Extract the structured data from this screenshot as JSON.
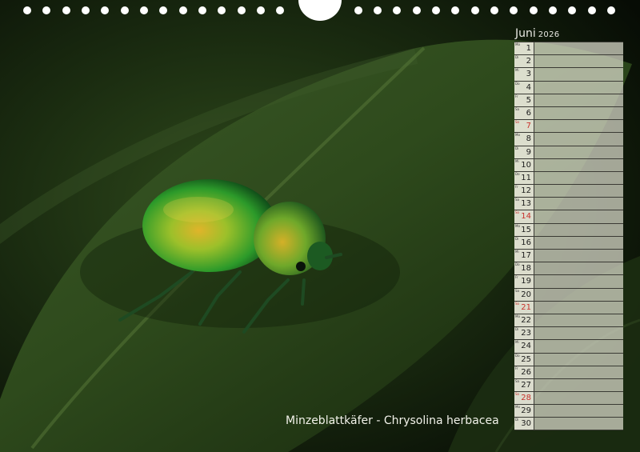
{
  "calendar": {
    "month": "Juni",
    "year": "2026",
    "days": [
      {
        "day": "1",
        "weekday": "Mo",
        "sunday": false
      },
      {
        "day": "2",
        "weekday": "Di",
        "sunday": false
      },
      {
        "day": "3",
        "weekday": "Mi",
        "sunday": false
      },
      {
        "day": "4",
        "weekday": "Do",
        "sunday": false
      },
      {
        "day": "5",
        "weekday": "Fr",
        "sunday": false
      },
      {
        "day": "6",
        "weekday": "Sa",
        "sunday": false
      },
      {
        "day": "7",
        "weekday": "So",
        "sunday": true
      },
      {
        "day": "8",
        "weekday": "Mo",
        "sunday": false
      },
      {
        "day": "9",
        "weekday": "Di",
        "sunday": false
      },
      {
        "day": "10",
        "weekday": "Mi",
        "sunday": false
      },
      {
        "day": "11",
        "weekday": "Do",
        "sunday": false
      },
      {
        "day": "12",
        "weekday": "Fr",
        "sunday": false
      },
      {
        "day": "13",
        "weekday": "Sa",
        "sunday": false
      },
      {
        "day": "14",
        "weekday": "So",
        "sunday": true
      },
      {
        "day": "15",
        "weekday": "Mo",
        "sunday": false
      },
      {
        "day": "16",
        "weekday": "Di",
        "sunday": false
      },
      {
        "day": "17",
        "weekday": "Mi",
        "sunday": false
      },
      {
        "day": "18",
        "weekday": "Do",
        "sunday": false
      },
      {
        "day": "19",
        "weekday": "Fr",
        "sunday": false
      },
      {
        "day": "20",
        "weekday": "Sa",
        "sunday": false
      },
      {
        "day": "21",
        "weekday": "So",
        "sunday": true
      },
      {
        "day": "22",
        "weekday": "Mo",
        "sunday": false
      },
      {
        "day": "23",
        "weekday": "Di",
        "sunday": false
      },
      {
        "day": "24",
        "weekday": "Mi",
        "sunday": false
      },
      {
        "day": "25",
        "weekday": "Do",
        "sunday": false
      },
      {
        "day": "26",
        "weekday": "Fr",
        "sunday": false
      },
      {
        "day": "27",
        "weekday": "Sa",
        "sunday": false
      },
      {
        "day": "28",
        "weekday": "So",
        "sunday": true
      },
      {
        "day": "29",
        "weekday": "Mo",
        "sunday": false
      },
      {
        "day": "30",
        "weekday": "Di",
        "sunday": false
      }
    ]
  },
  "caption": "Minzeblattkäfer - Chrysolina herbacea",
  "colors": {
    "sunday": "#c8322c",
    "binding_holes": "#ffffff",
    "calendar_cell": "#dcdccb"
  },
  "icons": [
    "spiral-binding-hole-icon",
    "hanger-notch-icon"
  ]
}
